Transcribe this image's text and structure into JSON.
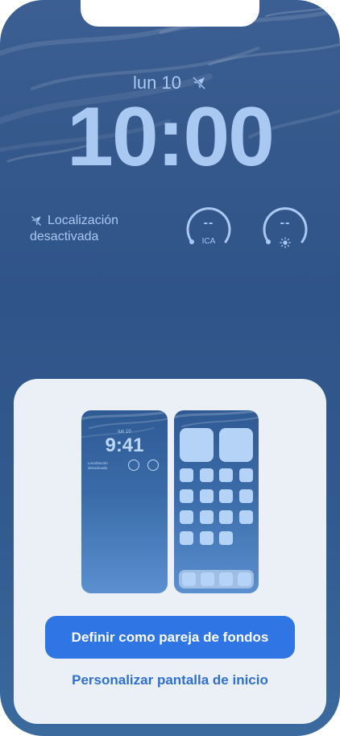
{
  "lockscreen": {
    "date": "lun 10",
    "time": "10:00",
    "location_line1": "Localización",
    "location_line2": "desactivada",
    "gauges": [
      {
        "value": "--",
        "label": "ICA"
      },
      {
        "value": "--",
        "label": ""
      }
    ]
  },
  "preview": {
    "lock_date": "lun 10",
    "lock_time": "9:41",
    "lock_loc_line1": "Localización",
    "lock_loc_line2": "desactivada",
    "lock_gauge_value": "--"
  },
  "actions": {
    "primary_label": "Definir como pareja de fondos",
    "secondary_label": "Personalizar pantalla de inicio"
  },
  "colors": {
    "accent": "#2f76e4",
    "link": "#2f6fd1",
    "lock_text": "#a9c8f2",
    "sheet": "#ebf0f7"
  },
  "icons": {
    "location_off": "location-off-icon",
    "weather": "sun-icon"
  }
}
